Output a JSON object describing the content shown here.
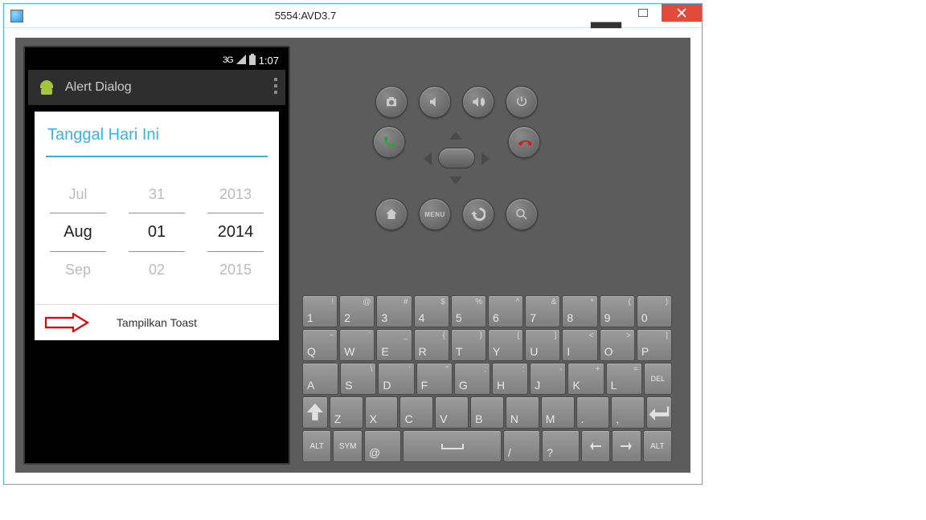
{
  "window": {
    "title": "5554:AVD3.7"
  },
  "statusbar": {
    "time": "1:07",
    "signal_label": "3G"
  },
  "appbar": {
    "title": "Alert Dialog"
  },
  "dialog": {
    "title": "Tanggal Hari Ini",
    "action_label": "Tampilkan Toast",
    "month": {
      "prev": "Jul",
      "cur": "Aug",
      "next": "Sep"
    },
    "day": {
      "prev": "31",
      "cur": "01",
      "next": "02"
    },
    "year": {
      "prev": "2013",
      "cur": "2014",
      "next": "2015"
    }
  },
  "hw": {
    "menu_label": "MENU"
  },
  "keyboard": {
    "row1": [
      {
        "main": "1",
        "sup": "!"
      },
      {
        "main": "2",
        "sup": "@"
      },
      {
        "main": "3",
        "sup": "#"
      },
      {
        "main": "4",
        "sup": "$"
      },
      {
        "main": "5",
        "sup": "%"
      },
      {
        "main": "6",
        "sup": "^"
      },
      {
        "main": "7",
        "sup": "&"
      },
      {
        "main": "8",
        "sup": "*"
      },
      {
        "main": "9",
        "sup": "("
      },
      {
        "main": "0",
        "sup": ")"
      }
    ],
    "row2": [
      {
        "main": "Q",
        "sup": "~"
      },
      {
        "main": "W",
        "sup": "`"
      },
      {
        "main": "E",
        "sup": "_"
      },
      {
        "main": "R",
        "sup": "{"
      },
      {
        "main": "T",
        "sup": "}"
      },
      {
        "main": "Y",
        "sup": "["
      },
      {
        "main": "U",
        "sup": "]"
      },
      {
        "main": "I",
        "sup": "<"
      },
      {
        "main": "O",
        "sup": ">"
      },
      {
        "main": "P",
        "sup": "|"
      }
    ],
    "row3": [
      {
        "main": "A",
        "sup": ""
      },
      {
        "main": "S",
        "sup": "\\"
      },
      {
        "main": "D",
        "sup": "'"
      },
      {
        "main": "F",
        "sup": "\""
      },
      {
        "main": "G",
        "sup": ";"
      },
      {
        "main": "H",
        "sup": ":"
      },
      {
        "main": "J",
        "sup": "-"
      },
      {
        "main": "K",
        "sup": "+"
      },
      {
        "main": "L",
        "sup": "="
      }
    ],
    "row3_del": "DEL",
    "row4": [
      {
        "main": "Z"
      },
      {
        "main": "X"
      },
      {
        "main": "C"
      },
      {
        "main": "V"
      },
      {
        "main": "B"
      },
      {
        "main": "N"
      },
      {
        "main": "M"
      },
      {
        "main": "."
      },
      {
        "main": ","
      }
    ],
    "row5": {
      "alt_l": "ALT",
      "sym": "SYM",
      "at": "@",
      "slash": "/",
      "q": "?",
      "alt_r": "ALT"
    }
  }
}
